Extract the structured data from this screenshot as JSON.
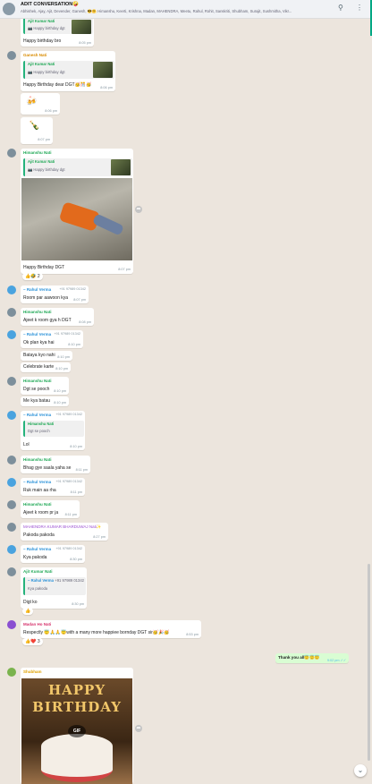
{
  "header": {
    "title": "ADIT CONVERSATION🤪",
    "members": "Abhishek, Ajay, Ajit, Devender, Ganesh, 😎🤗 Himanshu, Keerti, Krishna, Madan, MAHENDRA, Meetu, Rahul, Rohit, Sanskriti, Shubham, Surajit, Sushmitha, Vikr..."
  },
  "colors": {
    "ajit": "#1fa855",
    "ganesh": "#d98b00",
    "himanshu": "#1fa855",
    "rahul": "#2a91d8",
    "mahendra": "#9b4fd1",
    "madan": "#d6336c",
    "shubham": "#e0a100"
  },
  "messages": {
    "m1": {
      "quote_sender": "Ajit Kumar Nati",
      "quote_text": "📷 Happy birthday dgt",
      "text": "Happy birthday bro",
      "time": "8:05 pm"
    },
    "m2": {
      "sender": "Ganesh Nati",
      "quote_sender": "Ajit Kumar Nati",
      "quote_text": "📷 Happy birthday dgt",
      "text": "Happy Birthday dear DGT🥳🎊🥳",
      "time": "8:06 pm"
    },
    "m3": {
      "emoji": "🍻",
      "time": "8:06 pm"
    },
    "m4": {
      "emoji": "🍾",
      "time": "8:07 pm"
    },
    "m5": {
      "sender": "Himanshu Nati",
      "quote_sender": "Ajit Kumar Nati",
      "quote_text": "📷 Happy birthday dgt",
      "text": "Happy Birthday DGT",
      "time": "8:07 pm",
      "reaction": "👍🤣 2"
    },
    "m6": {
      "sender": "~ Rahul Verma",
      "phone": "+91 97989 01342",
      "text": "Room par aawoon kya",
      "time": "8:07 pm"
    },
    "m7": {
      "sender": "Himanshu Nati",
      "text": "Ajeet k room  gya h  DGT",
      "time": "8:08 pm"
    },
    "m8": {
      "sender": "~ Rahul Verma",
      "phone": "+91 97989 01342",
      "text": "Ok plan kya hai",
      "time": "8:10 pm"
    },
    "m9": {
      "text": "Bataya kyo nahi",
      "time": "8:10 pm"
    },
    "m10": {
      "text": "Celebrate karte",
      "time": "8:10 pm"
    },
    "m11": {
      "sender": "Himanshu Nati",
      "text": "Dgt se pooch",
      "time": "8:10 pm"
    },
    "m12": {
      "text": "Me kya batau",
      "time": "8:10 pm"
    },
    "m13": {
      "sender": "~ Rahul Verma",
      "phone": "+91 97989 01342",
      "quote_sender": "Himanshu Nati",
      "quote_text": "Dgt se pooch",
      "text": "Lol",
      "time": "8:10 pm"
    },
    "m14": {
      "sender": "Himanshu Nati",
      "text": "Bhag gye saala yaha se",
      "time": "8:11 pm"
    },
    "m15": {
      "sender": "~ Rahul Verma",
      "phone": "+91 97989 01342",
      "text": "Ruk main aa rha",
      "time": "8:11 pm"
    },
    "m16": {
      "sender": "Himanshu Nati",
      "text": "Ajeet k room pr ja",
      "time": "8:11 pm"
    },
    "m17": {
      "sender": "MAHENDRA KUMAR BHARDUWAJ Nati✨",
      "text": "Pakoda pakoda",
      "time": "8:27 pm"
    },
    "m18": {
      "sender": "~ Rahul Verma",
      "phone": "+91 97989 01342",
      "text": "Kya pakoda",
      "time": "8:30 pm"
    },
    "m19": {
      "sender": "Ajit Kumar Nati",
      "quote_sender": "~ Rahul Verma",
      "quote_phone": "+91 97989 01342",
      "quote_text": "Kya pakoda",
      "text": "Digt ko",
      "time": "8:30 pm",
      "reaction": "👍"
    },
    "m20": {
      "sender": "Madan Ho Nati",
      "text": "Respectly 😇🙏🙏😇with a many more happiee bornday DGT sir🥳🎉🥳",
      "time": "8:53 pm",
      "reaction": "👍❤️ 3"
    },
    "m21": {
      "text": "Thank you all😇😇😇",
      "time": "9:02 pm ✓✓"
    },
    "m22": {
      "sender": "Shubham",
      "gif_text": "HAPPY BIRTHDAY",
      "gif_label": "GIF"
    }
  }
}
